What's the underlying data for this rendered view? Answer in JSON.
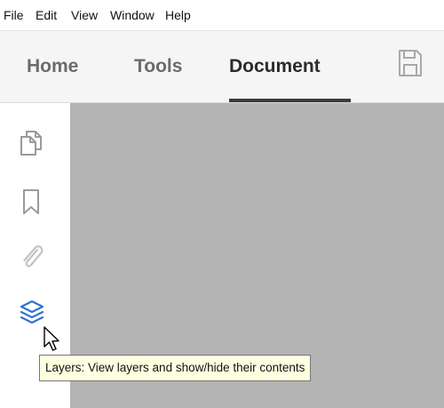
{
  "menubar": {
    "items": [
      {
        "label": "File"
      },
      {
        "label": "Edit"
      },
      {
        "label": "View"
      },
      {
        "label": "Window"
      },
      {
        "label": "Help"
      }
    ]
  },
  "tabs": {
    "items": [
      {
        "label": "Home",
        "active": false
      },
      {
        "label": "Tools",
        "active": false
      },
      {
        "label": "Document",
        "active": true
      }
    ],
    "save_icon": "save-icon"
  },
  "sidebar": {
    "buttons": [
      {
        "icon": "pages-icon",
        "state": "normal"
      },
      {
        "icon": "bookmark-icon",
        "state": "normal"
      },
      {
        "icon": "attachment-icon",
        "state": "disabled"
      },
      {
        "icon": "layers-icon",
        "state": "hovered"
      }
    ]
  },
  "tooltip": {
    "text": "Layers: View layers and show/hide their contents"
  },
  "colors": {
    "accent": "#2f74d0",
    "icon_gray": "#9a9a9a",
    "icon_disabled": "#c3c3c3",
    "doc_background": "#b4b4b4",
    "tooltip_background": "#ffffe1"
  }
}
